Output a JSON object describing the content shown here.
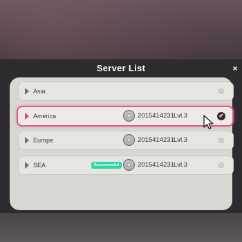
{
  "dialog": {
    "title": "Server List",
    "close_symbol": "×"
  },
  "servers": [
    {
      "name": "Asia",
      "badge": "",
      "account_id": "",
      "level": "",
      "selected": false
    },
    {
      "name": "America",
      "badge": "",
      "account_id": "2015414231",
      "level": "Lvl.3",
      "selected": true
    },
    {
      "name": "Europe",
      "badge": "",
      "account_id": "2015414231",
      "level": "Lvl.3",
      "selected": false
    },
    {
      "name": "SEA",
      "badge": "Recommended",
      "account_id": "2015414231",
      "level": "Lvl.3",
      "selected": false
    }
  ],
  "icons": {
    "row_arrow": "triangle-right-icon",
    "avatar": "avatar-icon",
    "selected_check": "check-icon",
    "cursor": "mouse-pointer-icon"
  },
  "colors": {
    "highlight": "#e05a8a",
    "badge": "#2fd6a4",
    "title_text": "#ffffff"
  }
}
